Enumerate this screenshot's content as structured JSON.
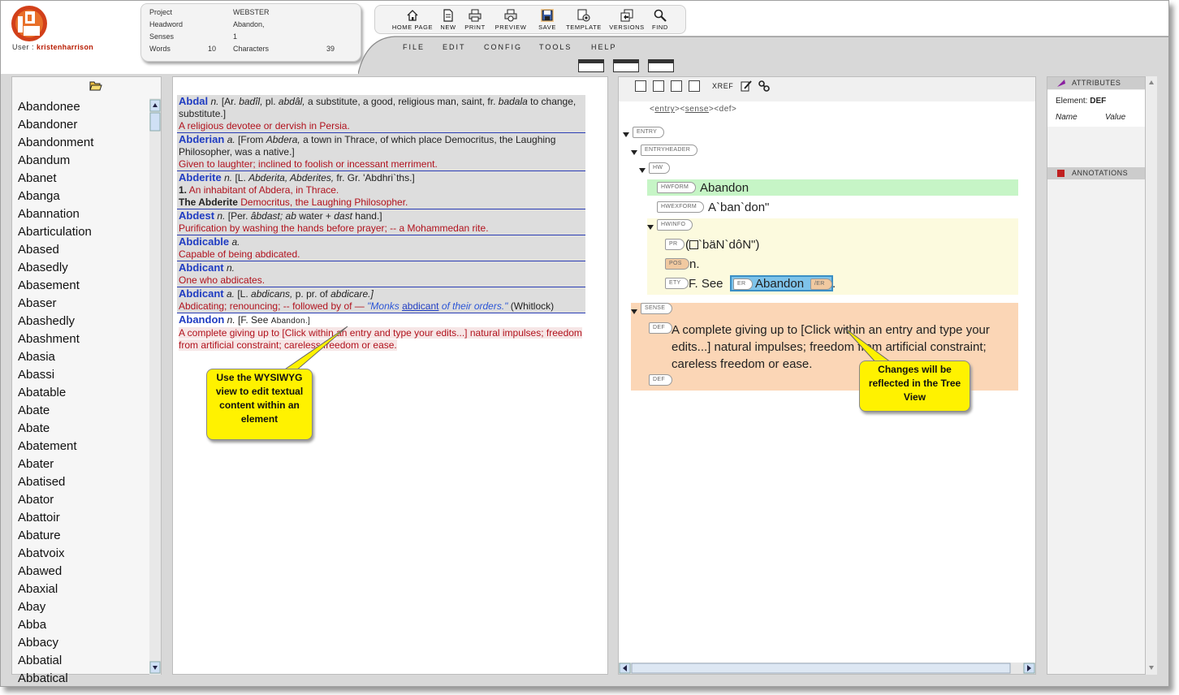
{
  "header": {
    "user_label": "User :",
    "user_name": "kristenharrison",
    "info": {
      "project_label": "Project",
      "project_value": "WEBSTER",
      "headword_label": "Headword",
      "headword_value": "Abandon,",
      "senses_label": "Senses",
      "senses_value": "1",
      "words_label": "Words",
      "words_value": "10",
      "characters_label": "Characters",
      "characters_value": "39"
    },
    "toolbar": [
      "HOME PAGE",
      "NEW",
      "PRINT",
      "PREVIEW",
      "SAVE",
      "TEMPLATE",
      "VERSIONS",
      "FIND"
    ],
    "menu": [
      "FILE",
      "EDIT",
      "CONFIG",
      "TOOLS",
      "HELP"
    ]
  },
  "wordlist": [
    "Abandonee",
    "Abandoner",
    "Abandonment",
    "Abandum",
    "Abanet",
    "Abanga",
    "Abannation",
    "Abarticulation",
    "Abased",
    "Abasedly",
    "Abasement",
    "Abaser",
    "Abashedly",
    "Abashment",
    "Abasia",
    "Abassi",
    "Abatable",
    "Abate",
    "Abate",
    "Abatement",
    "Abater",
    "Abatised",
    "Abator",
    "Abattoir",
    "Abature",
    "Abatvoix",
    "Abawed",
    "Abaxial",
    "Abay",
    "Abba",
    "Abbacy",
    "Abbatial",
    "Abbatical"
  ],
  "entries": {
    "abdal": {
      "hw": "Abdal",
      "pos": "n.",
      "etym_a": "[Ar.",
      "badil": "badîl,",
      "etym_b": "pl.",
      "abdal": "abdâl,",
      "etym_c": "a substitute, a good, religious man, saint, fr.",
      "badala": "badala",
      "etym_d": "to change, substitute.]",
      "def": "A religious devotee or dervish in Persia."
    },
    "abderian": {
      "hw": "Abderian",
      "pos": "a.",
      "etym_a": "[From",
      "abdera": "Abdera,",
      "etym_b": "a town in Thrace, of which place Democritus, the Laughing Philosopher, was a native.]",
      "def": "Given to laughter; inclined to foolish or incessant merriment."
    },
    "abderite": {
      "hw": "Abderite",
      "pos": "n.",
      "etym_a": "[L.",
      "abderita": "Abderita, Abderites,",
      "etym_b": "fr. Gr. 'Abdhri`ths.]",
      "num": "1.",
      "def1": "An inhabitant of Abdera, in Thrace.",
      "sub": "The Abderite",
      "def2": "Democritus, the Laughing Philosopher."
    },
    "abdest": {
      "hw": "Abdest",
      "pos": "n.",
      "etym_a": "[Per.",
      "abdast": "âbdast;",
      "ab": "ab",
      "etym_b": "water +",
      "dast": "dast",
      "etym_c": "hand.]",
      "def": "Purification by washing the hands before prayer; -- a Mohammedan rite."
    },
    "abdicable": {
      "hw": "Abdicable",
      "pos": "a.",
      "def": "Capable of being abdicated."
    },
    "abdicant_n": {
      "hw": "Abdicant",
      "pos": "n.",
      "def": "One who abdicates."
    },
    "abdicant_a": {
      "hw": "Abdicant",
      "pos": "a.",
      "etym_a": "[L.",
      "abdicans": "abdicans,",
      "etym_b": "p. pr. of",
      "abdicare": "abdicare.]",
      "def": "Abdicating; renouncing; -- followed by of —",
      "cite_a": "\"Monks",
      "cite_link": "abdicant",
      "cite_b": "of their orders.\"",
      "source": "(Whitlock)"
    },
    "abandon": {
      "hw": "Abandon",
      "pos": "n.",
      "etym_a": "[F. See",
      "etym_sc": "Abandon.]",
      "def": "A complete giving up to [Click within an entry and type your edits...] natural impulses; freedom from artificial constraint; careless freedom or ease."
    }
  },
  "tree": {
    "crumb": [
      "<",
      "entry",
      ">",
      "<",
      "sense",
      ">",
      "<def>"
    ],
    "xref": "XREF",
    "tags": {
      "entry": "ENTRY",
      "entryheader": "ENTRYHEADER",
      "hw": "HW",
      "hwform": "HWFORM",
      "hwexform": "HWEXFORM",
      "hwinfo": "HWINFO",
      "pr": "PR",
      "pos": "POS",
      "ety": "ETY",
      "er": "ER",
      "er_close": "/ER",
      "sense": "SENSE",
      "def": "DEF",
      "def2": "DEF"
    },
    "hwform_value": "Abandon",
    "hwexform_value": "A`ban`don\"",
    "pr_open": "(",
    "pr_value": "`bäN`dôN\")",
    "pos_value": "n.",
    "ety_value": "F. See",
    "er_value": "Abandon",
    "ety_end": ".",
    "def_value": "A complete giving up to [Click within an entry and type your edits...] natural impulses; freedom from artificial constraint; careless freedom or ease."
  },
  "attributes": {
    "title": "ATTRIBUTES",
    "element_label": "Element:",
    "element_value": "DEF",
    "name_col": "Name",
    "value_col": "Value",
    "annotations_title": "ANNOTATIONS"
  },
  "callouts": {
    "wysiwyg": "Use the WYSIWYG view to edit textual content within an element",
    "tree": "Changes will be reflected in the Tree View"
  },
  "colors": {
    "hwform_bg": "#c6f5c6",
    "hwinfo_bg": "#fcfade",
    "sense_bg": "#fbd6b6",
    "callout": "#fff200",
    "headword_blue": "#1f3cc2"
  }
}
